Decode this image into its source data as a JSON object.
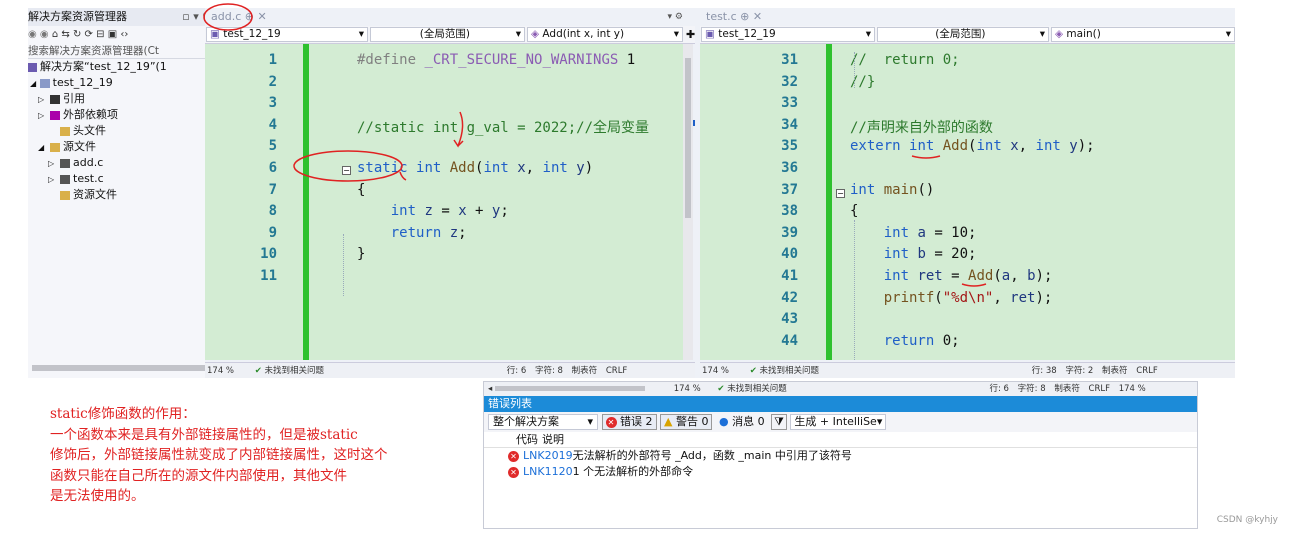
{
  "solution_explorer": {
    "title": "解决方案资源管理器",
    "title_controls": "▫ ▾ ⚲ ✕",
    "search_placeholder": "搜索解决方案资源管理器(Ct",
    "solution_label": "解决方案“test_12_19”(1",
    "project": "test_12_19",
    "items": [
      {
        "label": "引用",
        "expander": "▷",
        "icon": "reference-icon"
      },
      {
        "label": "外部依赖项",
        "expander": "▷",
        "icon": "external-deps-icon"
      },
      {
        "label": "头文件",
        "expander": "",
        "icon": "folder-icon"
      },
      {
        "label": "源文件",
        "expander": "◢",
        "icon": "folder-icon"
      },
      {
        "label": "add.c",
        "expander": "▷",
        "icon": "c-file-icon"
      },
      {
        "label": "test.c",
        "expander": "▷",
        "icon": "c-file-icon"
      },
      {
        "label": "资源文件",
        "expander": "",
        "icon": "folder-icon"
      }
    ]
  },
  "left_editor": {
    "tab_label": "add.c",
    "tab_pin": "⊕",
    "tab_close": "✕",
    "project_dd": "test_12_19",
    "scope_dd": "(全局范围)",
    "member_dd": "Add(int x, int y)",
    "lines": [
      {
        "n": "1",
        "html": "<span class='pp'>#define </span><span class='mac'>_CRT_SECURE_NO_WARNINGS</span> 1"
      },
      {
        "n": "2",
        "html": ""
      },
      {
        "n": "3",
        "html": ""
      },
      {
        "n": "4",
        "html": "<span class='cm'>//static int g_val = 2022;//全局变量</span>"
      },
      {
        "n": "5",
        "html": ""
      },
      {
        "n": "6",
        "html": "<span class='kw'>static</span> <span class='kw'>int</span> <span class='fn'>Add</span>(<span class='kw'>int</span> <span class='var'>x</span>, <span class='kw'>int</span> <span class='var'>y</span>)"
      },
      {
        "n": "7",
        "html": "{"
      },
      {
        "n": "8",
        "html": "    <span class='kw'>int</span> <span class='var'>z</span> = <span class='var'>x</span> + <span class='var'>y</span>;"
      },
      {
        "n": "9",
        "html": "    <span class='kw'>return</span> <span class='var'>z</span>;"
      },
      {
        "n": "10",
        "html": "}"
      },
      {
        "n": "11",
        "html": ""
      }
    ],
    "status": {
      "zoom": "174 %",
      "issues": "未找到相关问题",
      "line": "行: 6",
      "col": "字符: 8",
      "tab": "制表符",
      "eol": "CRLF"
    }
  },
  "right_editor": {
    "tab_label": "test.c",
    "tab_pin": "⊕",
    "tab_close": "✕",
    "project_dd": "test_12_19",
    "scope_dd": "(全局范围)",
    "member_dd": "main()",
    "lines": [
      {
        "n": "31",
        "html": "<span class='cm'>//  return 0;</span>"
      },
      {
        "n": "32",
        "html": "<span class='cm'>//}</span>"
      },
      {
        "n": "33",
        "html": ""
      },
      {
        "n": "34",
        "html": "<span class='cm'>//声明来自外部的函数</span>"
      },
      {
        "n": "35",
        "html": "<span class='kw'>extern</span> <span class='kw'>int</span> <span class='fn'>Add</span>(<span class='kw'>int</span> <span class='var'>x</span>, <span class='kw'>int</span> <span class='var'>y</span>);"
      },
      {
        "n": "36",
        "html": ""
      },
      {
        "n": "37",
        "html": "<span class='kw'>int</span> <span class='fn'>main</span>()"
      },
      {
        "n": "38",
        "html": "{"
      },
      {
        "n": "39",
        "html": "    <span class='kw'>int</span> <span class='var'>a</span> = 10;"
      },
      {
        "n": "40",
        "html": "    <span class='kw'>int</span> <span class='var'>b</span> = 20;"
      },
      {
        "n": "41",
        "html": "    <span class='kw'>int</span> <span class='var'>ret</span> = <span class='fn'>Add</span>(<span class='var'>a</span>, <span class='var'>b</span>);"
      },
      {
        "n": "42",
        "html": "    <span class='fn'>printf</span>(<span class='str'>\"%d\\n\"</span>, <span class='var'>ret</span>);"
      },
      {
        "n": "43",
        "html": ""
      },
      {
        "n": "44",
        "html": "    <span class='kw'>return</span> 0;"
      }
    ],
    "status": {
      "zoom": "174 %",
      "issues": "未找到相关问题",
      "line": "行: 38",
      "col": "字符: 2",
      "tab": "制表符",
      "eol": "CRLF"
    }
  },
  "error_list": {
    "top_status": {
      "zoom": "174 %",
      "issues": "未找到相关问题",
      "line": "行: 6",
      "col": "字符: 8",
      "tab": "制表符",
      "eol": "CRLF",
      "zoom2": "174 %"
    },
    "title": "错误列表",
    "scope": "整个解决方案",
    "errors": "错误 2",
    "warnings": "警告 0",
    "messages": "消息 0",
    "build": "生成 + IntelliSe",
    "col_code": "代码",
    "col_desc": "说明",
    "rows": [
      {
        "code": "LNK2019",
        "desc": "无法解析的外部符号 _Add，函数 _main 中引用了该符号"
      },
      {
        "code": "LNK1120",
        "desc": "1 个无法解析的外部命令"
      }
    ]
  },
  "note": {
    "lines": [
      "static修饰函数的作用：",
      "一个函数本来是具有外部链接属性的，但是被static",
      "修饰后，外部链接属性就变成了内部链接属性，这时这个",
      "函数只能在自己所在的源文件内部使用，其他文件",
      "是无法使用的。"
    ]
  },
  "watermark": "CSDN @kyhjy",
  "colors": {
    "editor_bg": "#d3ecd3",
    "change_bar": "#2ec12e",
    "annotation_red": "#e02222",
    "error_header": "#1c8bd8"
  }
}
